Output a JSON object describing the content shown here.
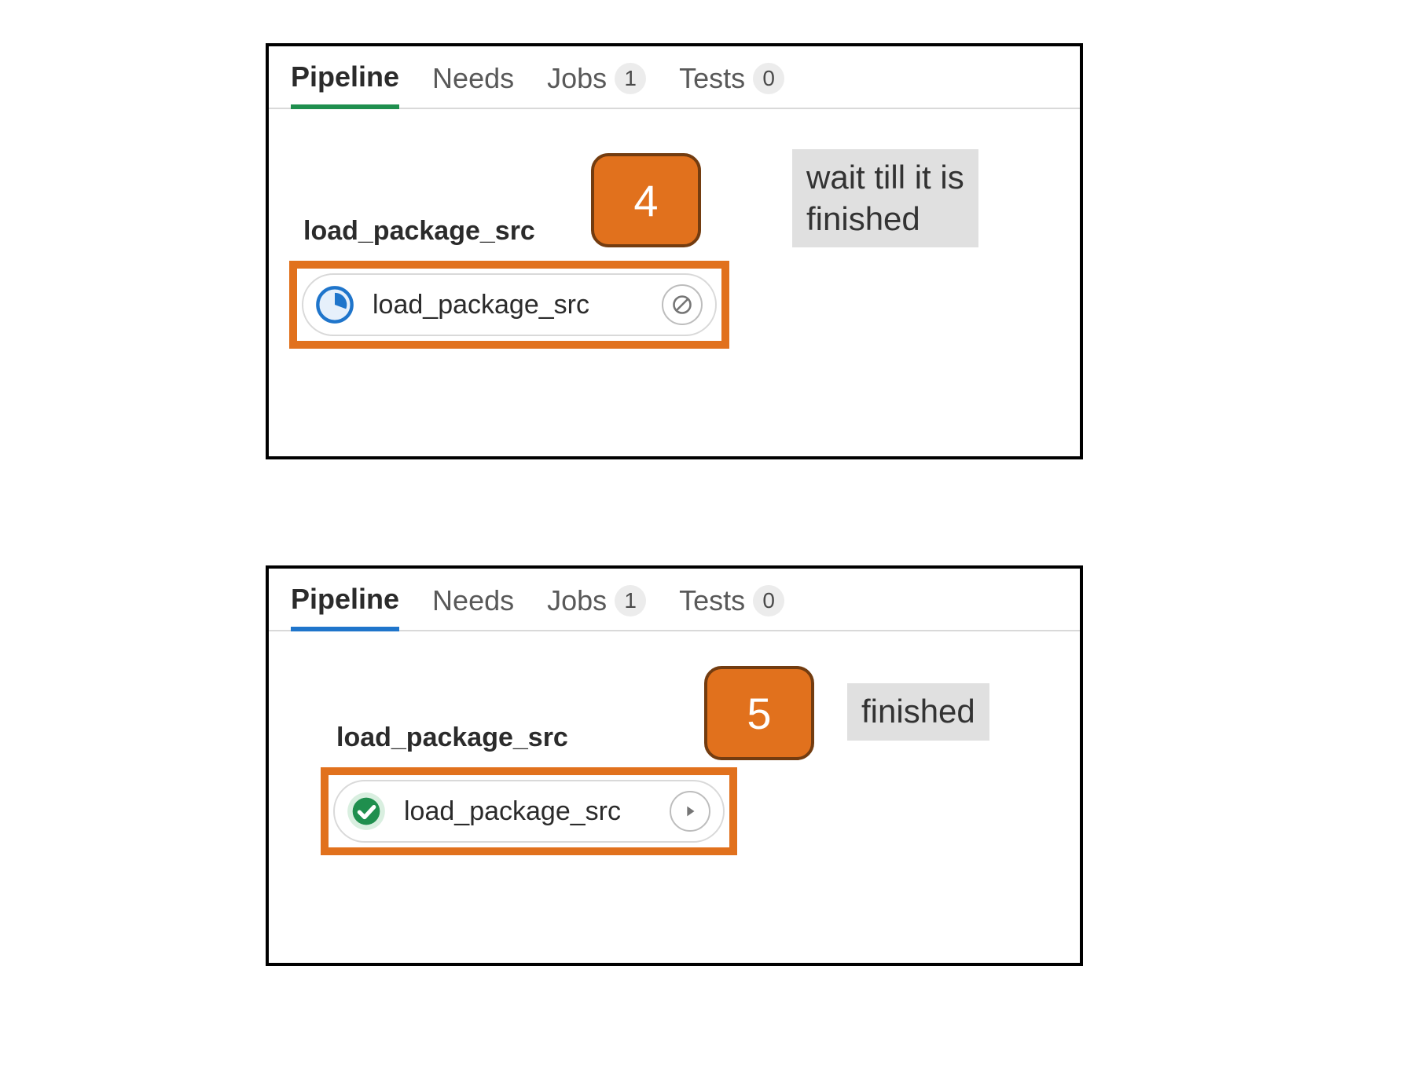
{
  "panels": [
    {
      "tabs": [
        {
          "label": "Pipeline",
          "count": null,
          "active": true
        },
        {
          "label": "Needs",
          "count": null,
          "active": false
        },
        {
          "label": "Jobs",
          "count": "1",
          "active": false
        },
        {
          "label": "Tests",
          "count": "0",
          "active": false
        }
      ],
      "accent": "green",
      "stage_name": "load_package_src",
      "job_name": "load_package_src",
      "job_status": "running",
      "step_number": "4",
      "callout": "wait till it is\nfinished"
    },
    {
      "tabs": [
        {
          "label": "Pipeline",
          "count": null,
          "active": true
        },
        {
          "label": "Needs",
          "count": null,
          "active": false
        },
        {
          "label": "Jobs",
          "count": "1",
          "active": false
        },
        {
          "label": "Tests",
          "count": "0",
          "active": false
        }
      ],
      "accent": "blue",
      "stage_name": "load_package_src",
      "job_name": "load_package_src",
      "job_status": "passed",
      "step_number": "5",
      "callout": "finished"
    }
  ]
}
